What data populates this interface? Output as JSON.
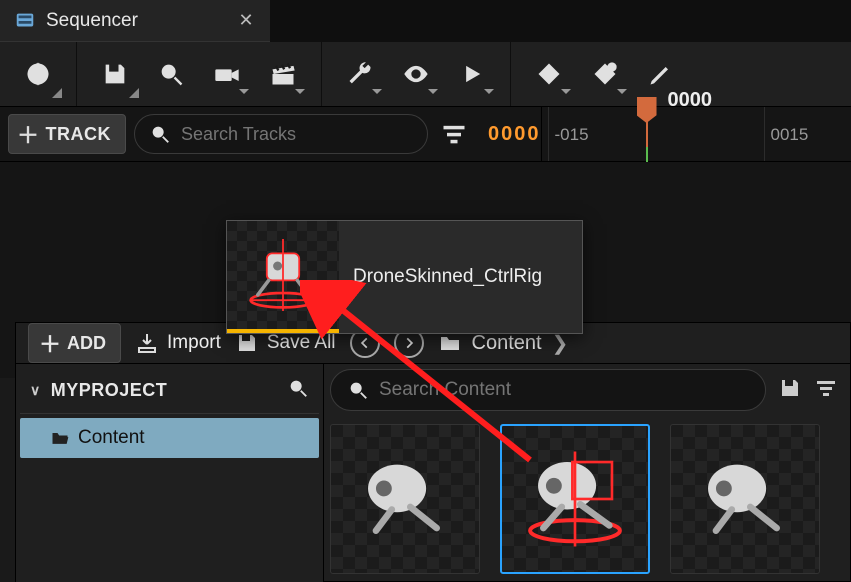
{
  "tab": {
    "title": "Sequencer"
  },
  "tracks": {
    "add_label": "TRACK",
    "search_placeholder": "Search Tracks",
    "current_frame": "0000"
  },
  "timeline": {
    "playhead_label": "0000",
    "tick_left": "-015",
    "tick_right": "0015"
  },
  "drag": {
    "asset_name": "DroneSkinned_CtrlRig"
  },
  "cb": {
    "add_label": "ADD",
    "import_label": "Import",
    "saveall_label": "Save All",
    "breadcrumb": "Content",
    "project": "MYPROJECT",
    "tree_item": "Content",
    "search_placeholder": "Search Content"
  }
}
